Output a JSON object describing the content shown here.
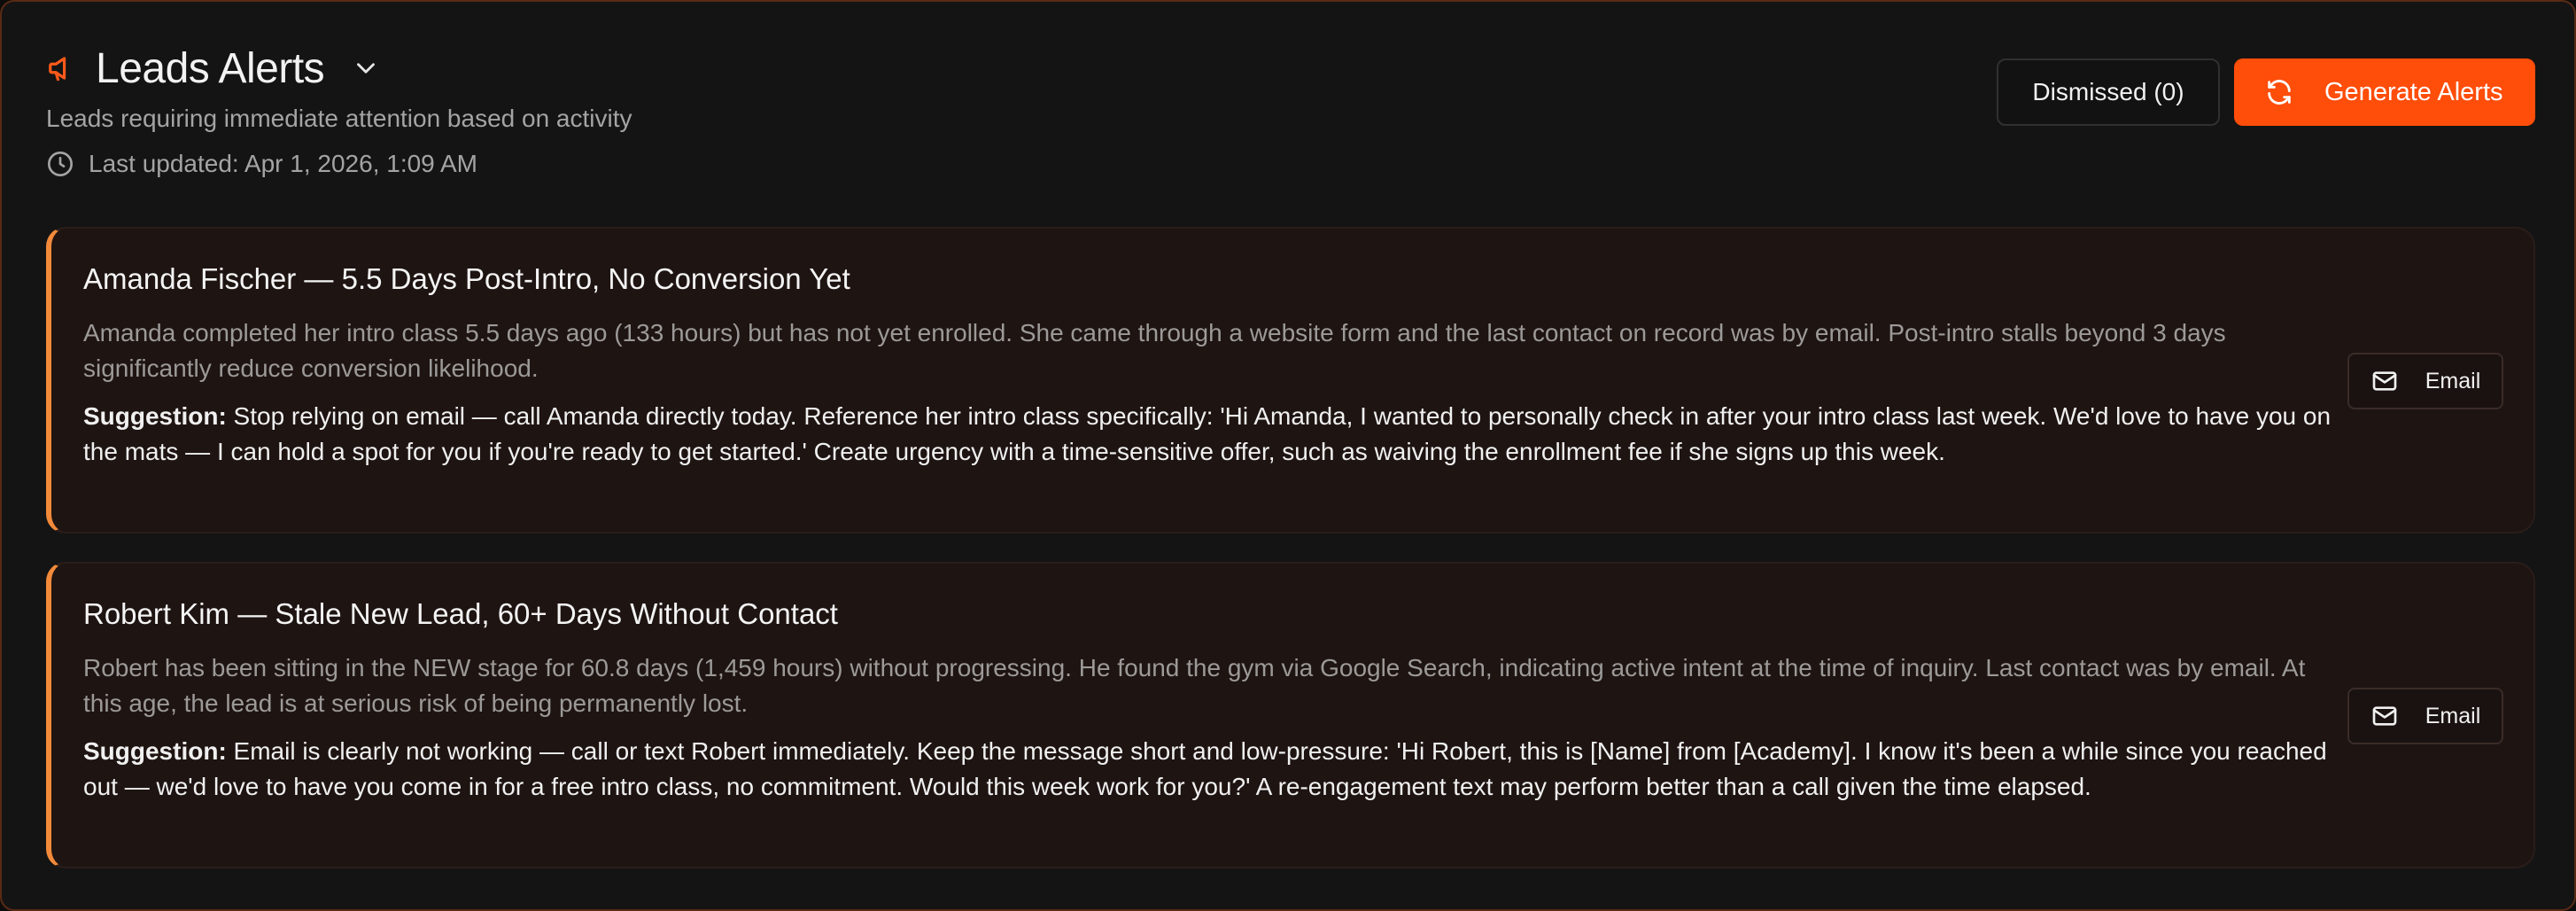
{
  "header": {
    "title": "Leads Alerts",
    "subtitle": "Leads requiring immediate attention based on activity",
    "last_updated": "Last updated: Apr 1, 2026, 1:09 AM",
    "dismissed_label": "Dismissed (0)",
    "generate_label": "Generate Alerts"
  },
  "colors": {
    "accent": "#ff4d0a",
    "card_border": "#f28a3a",
    "background": "#141414"
  },
  "icons": {
    "title": "megaphone-icon",
    "dropdown": "chevron-down-icon",
    "updated": "clock-icon",
    "generate": "refresh-icon",
    "email": "mail-icon"
  },
  "alerts": [
    {
      "title": "Amanda Fischer — 5.5 Days Post-Intro, No Conversion Yet",
      "description": "Amanda completed her intro class 5.5 days ago (133 hours) but has not yet enrolled. She came through a website form and the last contact on record was by email. Post-intro stalls beyond 3 days significantly reduce conversion likelihood.",
      "suggestion_label": "Suggestion:",
      "suggestion_text": "Stop relying on email — call Amanda directly today. Reference her intro class specifically: 'Hi Amanda, I wanted to personally check in after your intro class last week. We'd love to have you on the mats — I can hold a spot for you if you're ready to get started.' Create urgency with a time-sensitive offer, such as waiving the enrollment fee if she signs up this week.",
      "email_label": "Email"
    },
    {
      "title": "Robert Kim — Stale New Lead, 60+ Days Without Contact",
      "description": "Robert has been sitting in the NEW stage for 60.8 days (1,459 hours) without progressing. He found the gym via Google Search, indicating active intent at the time of inquiry. Last contact was by email. At this age, the lead is at serious risk of being permanently lost.",
      "suggestion_label": "Suggestion:",
      "suggestion_text": "Email is clearly not working — call or text Robert immediately. Keep the message short and low-pressure: 'Hi Robert, this is [Name] from [Academy]. I know it's been a while since you reached out — we'd love to have you come in for a free intro class, no commitment. Would this week work for you?' A re-engagement text may perform better than a call given the time elapsed.",
      "email_label": "Email"
    }
  ]
}
